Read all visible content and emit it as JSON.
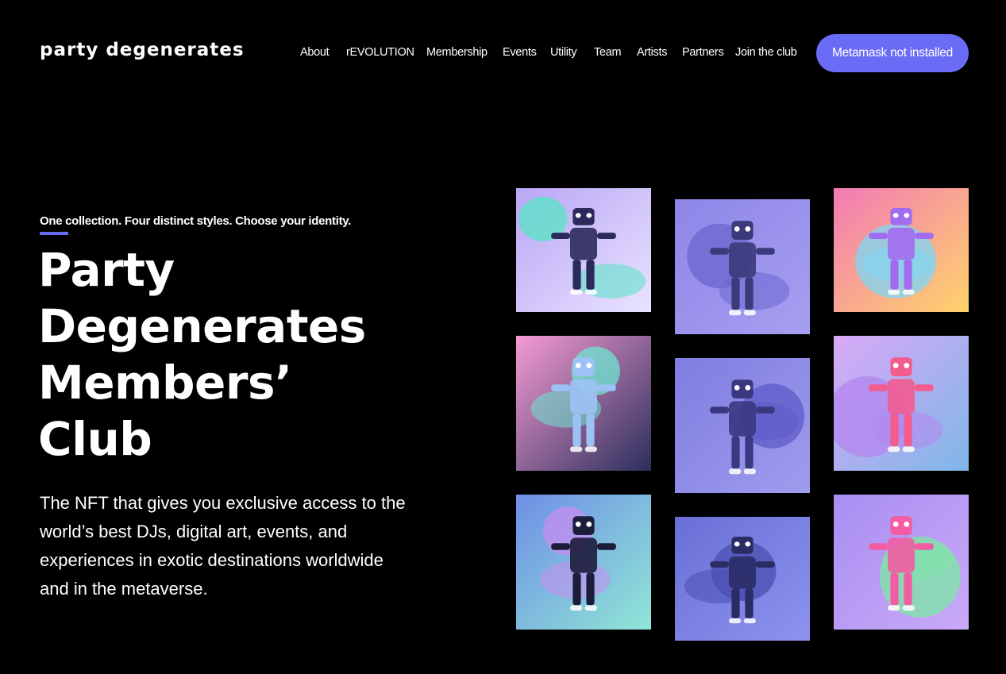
{
  "brand": {
    "logo_text": "party degenerates"
  },
  "nav": {
    "items": [
      {
        "label": "About",
        "name": "nav-about"
      },
      {
        "label": "rEVOLUTION",
        "name": "nav-revolution"
      },
      {
        "label": "Membership",
        "name": "nav-membership"
      },
      {
        "label": "Events",
        "name": "nav-events"
      },
      {
        "label": "Utility",
        "name": "nav-utility"
      },
      {
        "label": "Team",
        "name": "nav-team"
      },
      {
        "label": "Artists",
        "name": "nav-artists"
      },
      {
        "label": "Partners",
        "name": "nav-partners"
      },
      {
        "label": "Join the club",
        "name": "nav-join-the-club"
      }
    ],
    "metamask_button": "Metamask not installed"
  },
  "hero": {
    "eyebrow": "One collection. Four distinct styles. Choose your identity.",
    "title_lines": [
      "Party",
      "Degenerates",
      "Members’",
      "Club"
    ],
    "description": "The NFT that gives you exclusive access to the world’s best DJs, digital art, events, and experiences in exotic destinations worldwide and in the metaverse."
  },
  "colors": {
    "accent": "#6a6cf6",
    "background": "#000000"
  },
  "gallery": {
    "tiles": [
      {
        "name": "nft-art-1",
        "palette": [
          "#b9a6f5",
          "#56e6c4",
          "#2b2a5c",
          "#e9e3ff"
        ]
      },
      {
        "name": "nft-art-2",
        "palette": [
          "#8e86e8",
          "#6b66cf",
          "#3b3a7a",
          "#a69ff0"
        ]
      },
      {
        "name": "nft-art-3",
        "palette": [
          "#f27ab5",
          "#7ed7f5",
          "#a36cf0",
          "#ffd36b"
        ]
      },
      {
        "name": "nft-art-4",
        "palette": [
          "#f59bd3",
          "#6de6d0",
          "#9cc2f5",
          "#2b2f5c"
        ]
      },
      {
        "name": "nft-art-5",
        "palette": [
          "#7f7de0",
          "#5f5bc8",
          "#3a3880",
          "#9f9cee"
        ]
      },
      {
        "name": "nft-art-6",
        "palette": [
          "#d9a9f7",
          "#b486f0",
          "#f25c8f",
          "#7fb7e8"
        ]
      },
      {
        "name": "nft-art-7",
        "palette": [
          "#6f8fe6",
          "#c68ef0",
          "#1c1c3b",
          "#8fe6d6"
        ]
      },
      {
        "name": "nft-art-8",
        "palette": [
          "#6a6fd6",
          "#4b4fb0",
          "#2a2c66",
          "#8e93ee"
        ]
      },
      {
        "name": "nft-art-9",
        "palette": [
          "#a98ef2",
          "#7ee8a6",
          "#f25ca3",
          "#c9a9f7"
        ]
      }
    ]
  }
}
